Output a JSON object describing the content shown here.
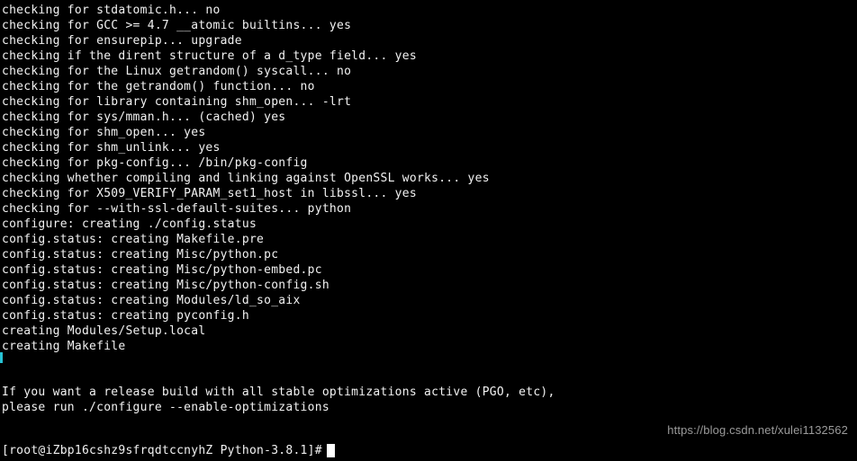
{
  "terminal": {
    "background_color": "#000000",
    "text_color": "#f2f2f2",
    "accent_color": "#27c2d4",
    "cursor_color": "#ffffff",
    "lines": [
      "checking for stdatomic.h... no",
      "checking for GCC >= 4.7 __atomic builtins... yes",
      "checking for ensurepip... upgrade",
      "checking if the dirent structure of a d_type field... yes",
      "checking for the Linux getrandom() syscall... no",
      "checking for the getrandom() function... no",
      "checking for library containing shm_open... -lrt",
      "checking for sys/mman.h... (cached) yes",
      "checking for shm_open... yes",
      "checking for shm_unlink... yes",
      "checking for pkg-config... /bin/pkg-config",
      "checking whether compiling and linking against OpenSSL works... yes",
      "checking for X509_VERIFY_PARAM_set1_host in libssl... yes",
      "checking for --with-ssl-default-suites... python",
      "configure: creating ./config.status",
      "config.status: creating Makefile.pre",
      "config.status: creating Misc/python.pc",
      "config.status: creating Misc/python-embed.pc",
      "config.status: creating Misc/python-config.sh",
      "config.status: creating Modules/ld_so_aix",
      "config.status: creating pyconfig.h",
      "creating Modules/Setup.local",
      "creating Makefile",
      "",
      "",
      "If you want a release build with all stable optimizations active (PGO, etc),",
      "please run ./configure --enable-optimizations",
      "",
      ""
    ],
    "prompt": "[root@iZbp16cshz9sfrqdtccnyhZ Python-3.8.1]#",
    "cursor": "block-cursor"
  },
  "watermark": {
    "text": "https://blog.csdn.net/xulei1132562"
  }
}
